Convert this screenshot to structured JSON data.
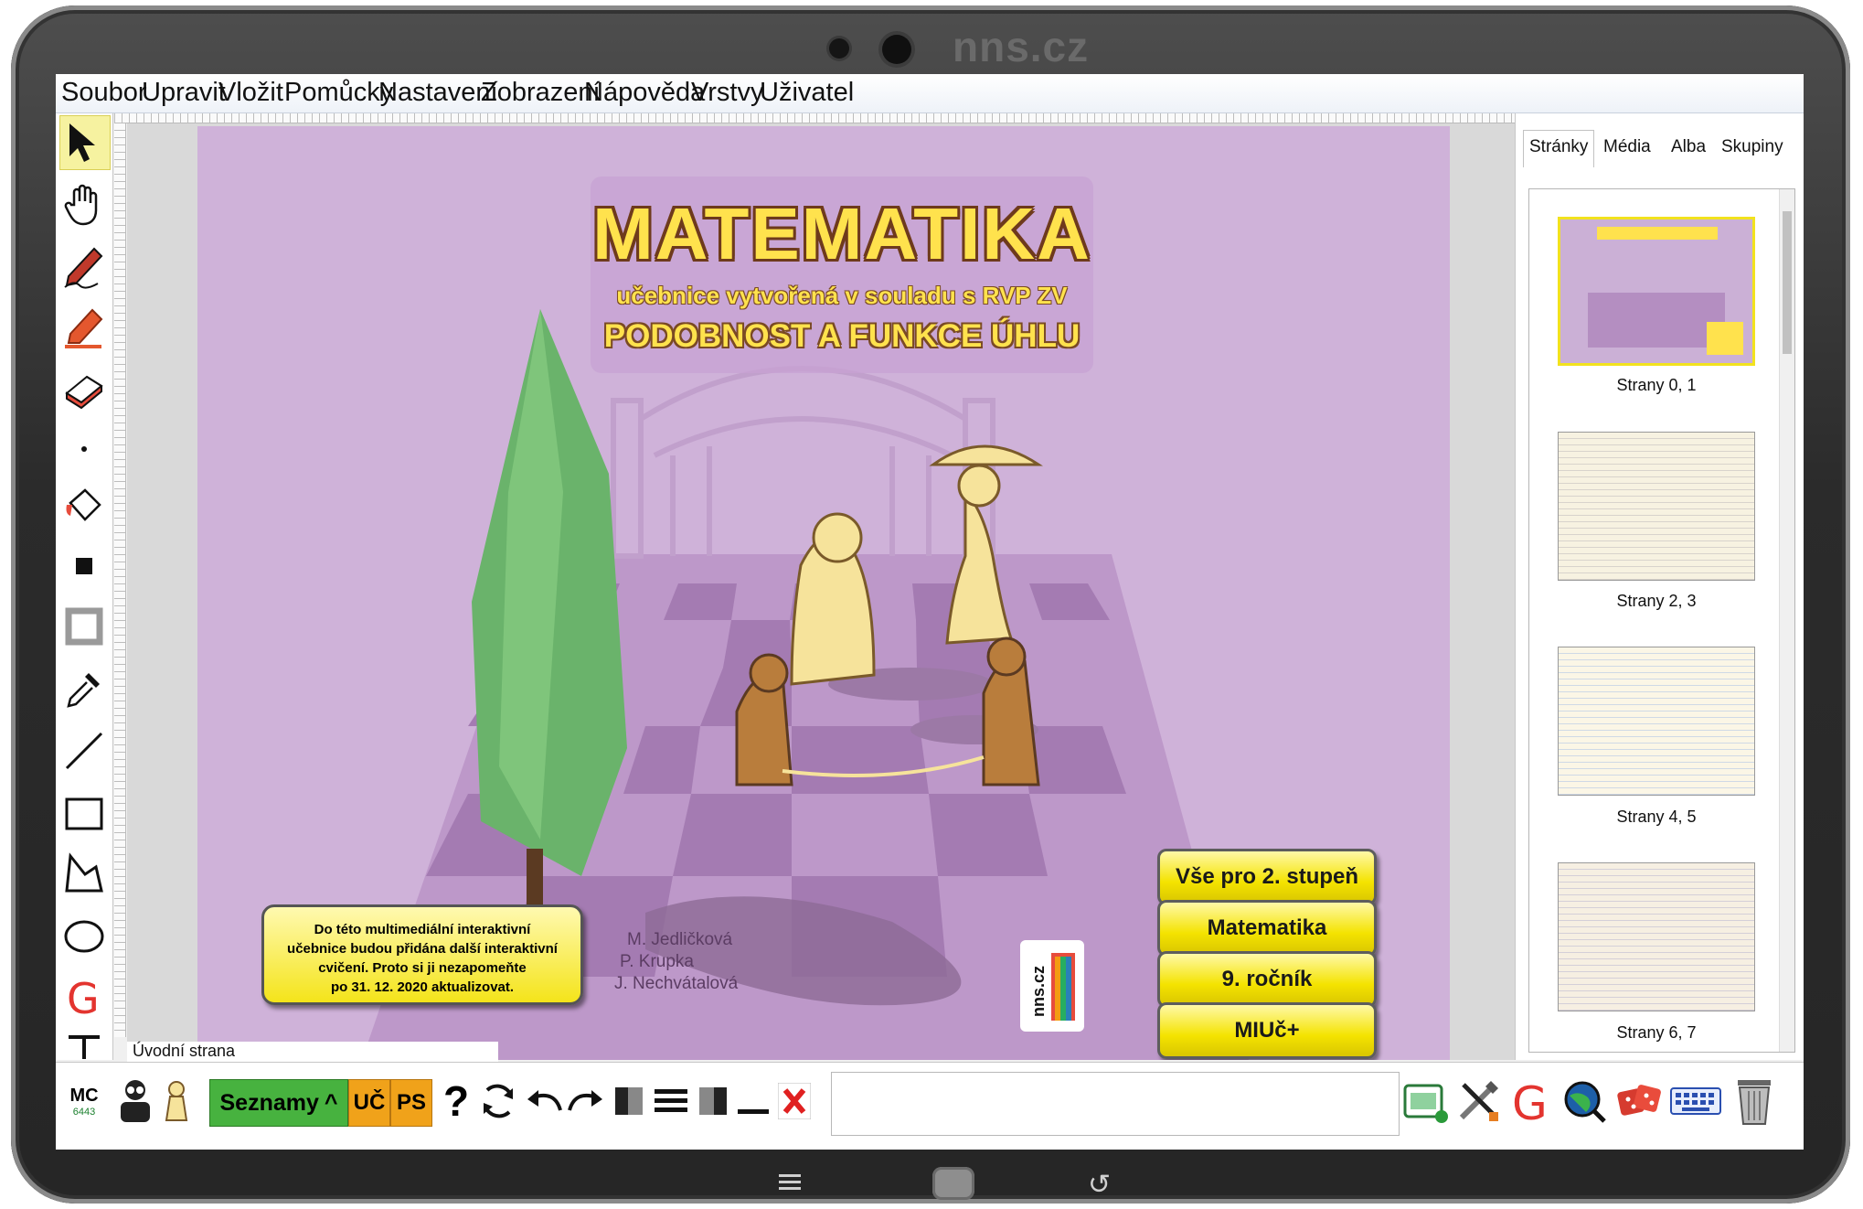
{
  "device": {
    "brand": "nns.cz"
  },
  "menu": [
    "Soubor",
    "Upravit",
    "Vložit",
    "Pomůcky",
    "Nastavení",
    "Zobrazení",
    "Nápověda",
    "Vrstvy",
    "Uživatel"
  ],
  "page": {
    "title": "MATEMATIKA",
    "subtitle": "učebnice vytvořená v souladu s RVP ZV",
    "topic": "PODOBNOST A FUNKCE ÚHLU",
    "buttons": [
      "Vše pro 2. stupeň",
      "Matematika",
      "9. ročník",
      "MIUč+"
    ],
    "notice": [
      "Do této multimediální interaktivní",
      "učebnice budou přidána další interaktivní",
      "cvičení. Proto si ji nezapomeňte",
      "po 31. 12. 2020 aktualizovat."
    ],
    "authors": [
      "M. Jedličková",
      "P. Krupka",
      "J. Nechvátalová"
    ],
    "logo_text": "nns.cz",
    "label": "Úvodní strana"
  },
  "panel": {
    "tabs": [
      "Stránky",
      "Média",
      "Alba",
      "Skupiny"
    ],
    "thumbnails": [
      "Strany 0, 1",
      "Strany 2, 3",
      "Strany 4, 5",
      "Strany 6, 7"
    ]
  },
  "bottom": {
    "mc_label": "MC",
    "mc_number": "6443",
    "seznamy": "Seznamy",
    "seznamy_arrow": "^",
    "uc": "UČ",
    "ps": "PS",
    "question": "?"
  },
  "colors": {
    "page_bg": "#cfb2d9",
    "title_yellow": "#ffe24d",
    "button_yellow": "#f4e300",
    "seznamy_green": "#47b23f",
    "uc_orange": "#f0a21a"
  }
}
